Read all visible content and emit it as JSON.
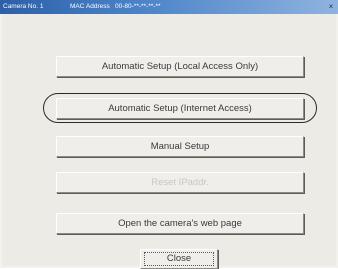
{
  "window": {
    "camera_no": "Camera No. 1",
    "mac_label": "MAC Address",
    "mac_value": "00-80-**-**-**-**"
  },
  "buttons": {
    "auto_local": "Automatic Setup (Local Access Only)",
    "auto_internet": "Automatic Setup (Internet Access)",
    "manual": "Manual Setup",
    "reset": "Reset IPaddr.",
    "open_web": "Open the camera's web page",
    "close": "Close"
  },
  "state": {
    "reset_enabled": false,
    "highlighted": "auto_internet"
  },
  "icons": {
    "title_close": "close-icon"
  }
}
